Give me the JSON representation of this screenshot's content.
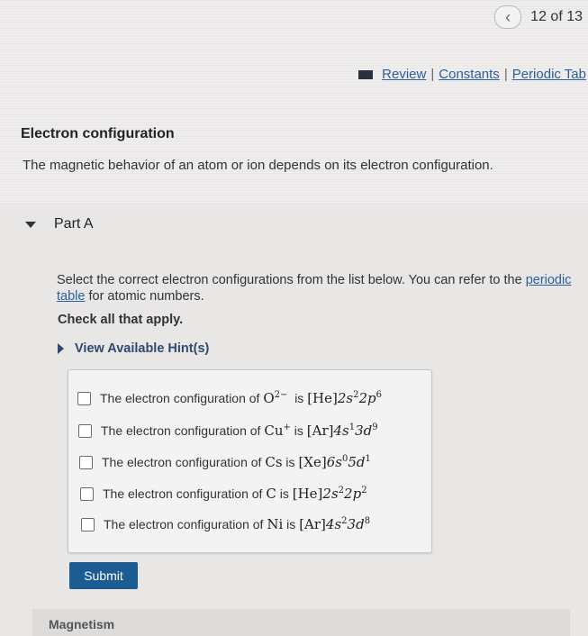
{
  "nav": {
    "prev_icon": "chevron-left-icon",
    "counter": "12 of 13"
  },
  "links": {
    "review": "Review",
    "constants": "Constants",
    "periodic": "Periodic Tab",
    "separator": "|"
  },
  "header": {
    "title": "Electron configuration",
    "intro": "The magnetic behavior of an atom or ion depends on its electron configuration."
  },
  "part": {
    "label": "Part A"
  },
  "instructions": {
    "text_before": "Select the correct electron configurations from the list below. You can refer to the ",
    "link": "periodic table",
    "text_after": " for atomic numbers.",
    "check_all": "Check all that apply.",
    "hints": "View Available Hint(s)"
  },
  "options": [
    {
      "prefix": "The electron configuration of",
      "species": "O",
      "charge": "2−",
      "is": "is",
      "core": "[He]",
      "config": "2s",
      "e1": "2",
      "config2": "2p",
      "e2": "6"
    },
    {
      "prefix": "The electron configuration of",
      "species": "Cu",
      "charge": "+",
      "is": "is",
      "core": "[Ar]",
      "config": "4s",
      "e1": "1",
      "config2": "3d",
      "e2": "9"
    },
    {
      "prefix": "The electron configuration of",
      "species": "Cs",
      "charge": "",
      "is": "is",
      "core": "[Xe]",
      "config": "6s",
      "e1": "0",
      "config2": "5d",
      "e2": "1"
    },
    {
      "prefix": "The electron configuration of",
      "species": "C",
      "charge": "",
      "is": "is",
      "core": "[He]",
      "config": "2s",
      "e1": "2",
      "config2": "2p",
      "e2": "2"
    },
    {
      "prefix": "The electron configuration of",
      "species": "Ni",
      "charge": "",
      "is": "is",
      "core": "[Ar]",
      "config": "4s",
      "e1": "2",
      "config2": "3d",
      "e2": "8"
    }
  ],
  "submit_label": "Submit",
  "next_section": "Magnetism"
}
